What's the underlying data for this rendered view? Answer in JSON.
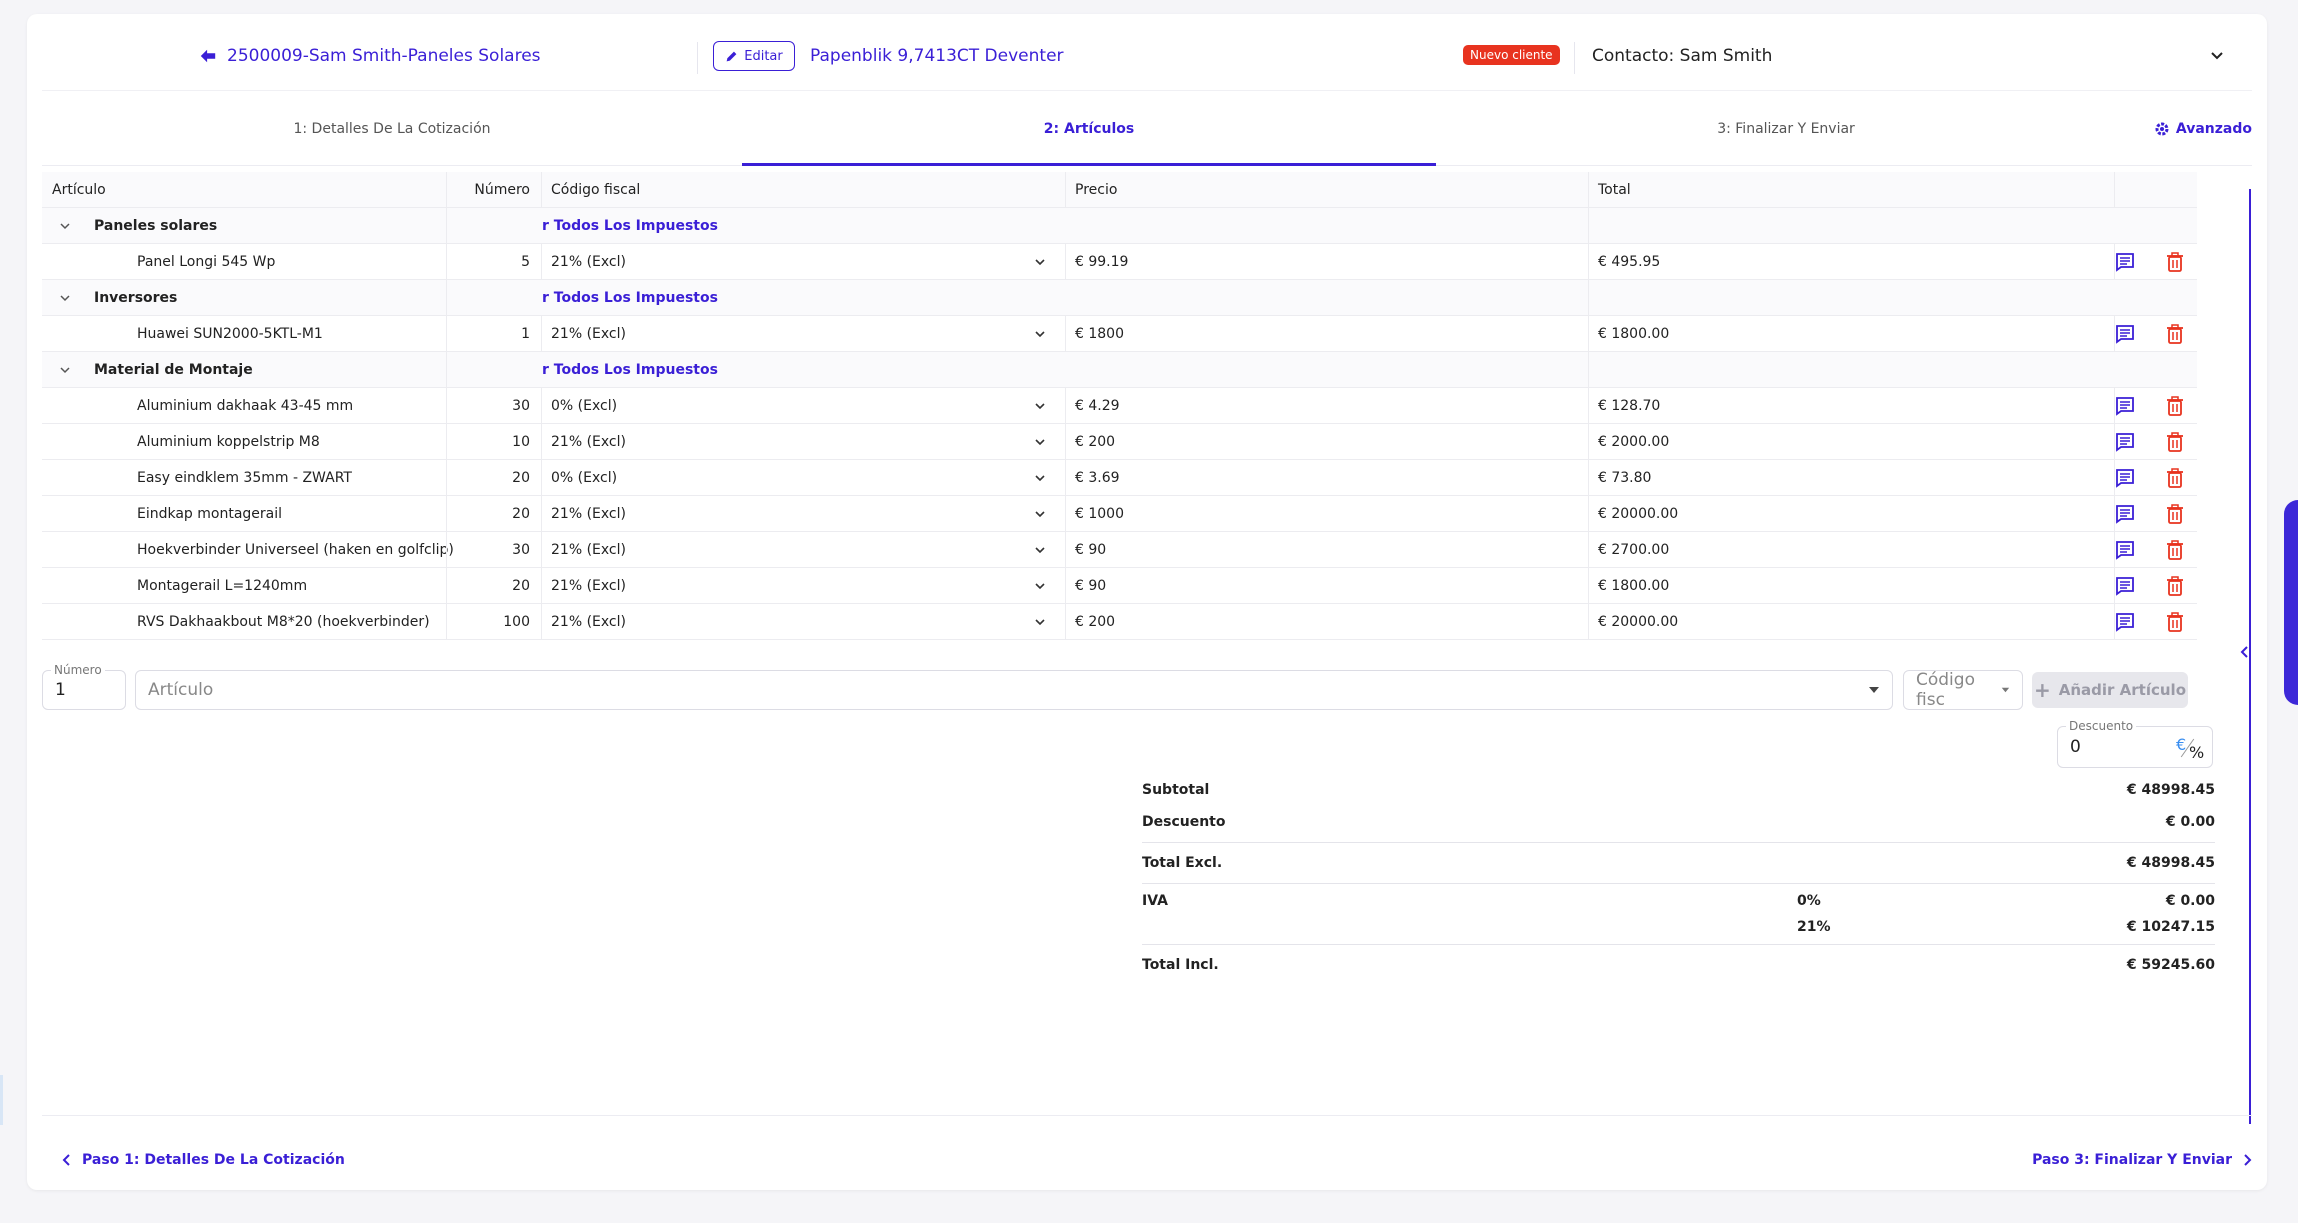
{
  "header": {
    "quote_title": "2500009-Sam Smith-Paneles Solares",
    "edit_label": "Editar",
    "address": "Papenblik 9,7413CT Deventer",
    "badge": "Nuevo cliente",
    "contact": "Contacto: Sam Smith"
  },
  "steps": [
    {
      "label": "1: Detalles De La Cotización"
    },
    {
      "label": "2: Artículos"
    },
    {
      "label": "3: Finalizar Y Enviar"
    }
  ],
  "advanced_label": "Avanzado",
  "columns": {
    "article": "Artículo",
    "number": "Número",
    "tax": "Código fiscal",
    "price": "Precio",
    "total": "Total"
  },
  "groups": [
    {
      "name": "Paneles solares",
      "link": "r Todos Los Impuestos",
      "items": [
        {
          "name": "Panel Longi 545 Wp",
          "qty": "5",
          "tax": "21% (Excl)",
          "price": "€ 99.19",
          "total": "€ 495.95"
        }
      ]
    },
    {
      "name": "Inversores",
      "link": "r Todos Los Impuestos",
      "items": [
        {
          "name": "Huawei SUN2000-5KTL-M1",
          "qty": "1",
          "tax": "21% (Excl)",
          "price": "€ 1800",
          "total": "€ 1800.00"
        }
      ]
    },
    {
      "name": "Material de Montaje",
      "link": "r Todos Los Impuestos",
      "items": [
        {
          "name": "Aluminium dakhaak 43-45 mm",
          "qty": "30",
          "tax": "0% (Excl)",
          "price": "€ 4.29",
          "total": "€ 128.70"
        },
        {
          "name": "Aluminium koppelstrip M8",
          "qty": "10",
          "tax": "21% (Excl)",
          "price": "€ 200",
          "total": "€ 2000.00"
        },
        {
          "name": "Easy eindklem 35mm - ZWART",
          "qty": "20",
          "tax": "0% (Excl)",
          "price": "€ 3.69",
          "total": "€ 73.80"
        },
        {
          "name": "Eindkap montagerail",
          "qty": "20",
          "tax": "21% (Excl)",
          "price": "€ 1000",
          "total": "€ 20000.00"
        },
        {
          "name": "Hoekverbinder Universeel (haken en golfclip)",
          "qty": "30",
          "tax": "21% (Excl)",
          "price": "€ 90",
          "total": "€ 2700.00"
        },
        {
          "name": "Montagerail L=1240mm",
          "qty": "20",
          "tax": "21% (Excl)",
          "price": "€ 90",
          "total": "€ 1800.00"
        },
        {
          "name": "RVS Dakhaakbout M8*20 (hoekverbinder)",
          "qty": "100",
          "tax": "21% (Excl)",
          "price": "€ 200",
          "total": "€ 20000.00"
        }
      ]
    }
  ],
  "add_row": {
    "number_label": "Número",
    "number_value": "1",
    "article_placeholder": "Artículo",
    "tax_placeholder": "Código fisc",
    "add_button": "Añadir Artículo"
  },
  "discount": {
    "label": "Descuento",
    "value": "0",
    "eur": "€",
    "pct": "%"
  },
  "totals": {
    "subtotal_label": "Subtotal",
    "subtotal": "€ 48998.45",
    "discount_label": "Descuento",
    "discount": "€ 0.00",
    "excl_label": "Total Excl.",
    "excl": "€ 48998.45",
    "vat_label": "IVA",
    "vat_rows": [
      {
        "rate": "0%",
        "amount": "€ 0.00"
      },
      {
        "rate": "21%",
        "amount": "€ 10247.15"
      }
    ],
    "incl_label": "Total Incl.",
    "incl": "€ 59245.60"
  },
  "footer": {
    "prev": "Paso 1: Detalles De La Cotización",
    "next": "Paso 3: Finalizar Y Enviar"
  },
  "colors": {
    "accent": "#3a1fd6",
    "danger": "#e8331f"
  }
}
